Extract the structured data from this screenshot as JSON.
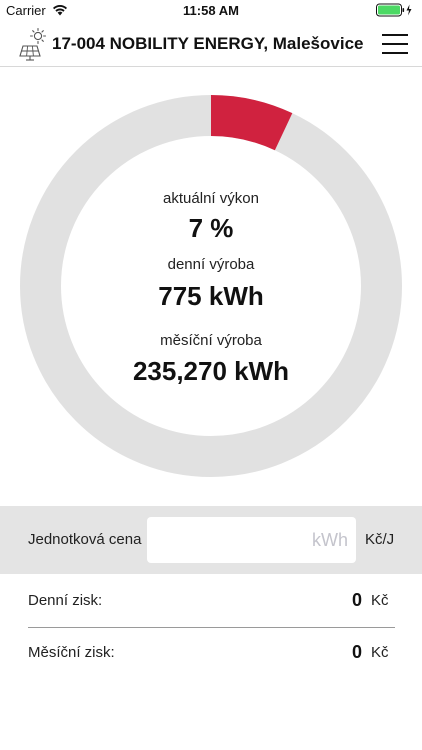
{
  "status_bar": {
    "carrier": "Carrier",
    "time": "11:58 AM",
    "battery_color": "#4cd964"
  },
  "header": {
    "title": "17-004 NOBILITY ENERGY, Malešovice",
    "icons": [
      "solar-panel-icon",
      "hamburger-menu-icon"
    ]
  },
  "gauge": {
    "percent": 7,
    "fill_color": "#d0223f",
    "track_color": "#e1e1e1",
    "current_power_label": "aktuální výkon",
    "current_power_value": "7 %",
    "daily_production_label": "denní výroba",
    "daily_production_value": "775 kWh",
    "monthly_production_label": "měsíční výroba",
    "monthly_production_value": "235,270 kWh"
  },
  "price": {
    "label": "Jednotková cena",
    "placeholder": "kWh",
    "value": "",
    "unit": "Kč/J"
  },
  "profit": {
    "daily_label": "Denní zisk:",
    "daily_value": "0",
    "daily_unit": "Kč",
    "monthly_label": "Měsíční zisk:",
    "monthly_value": "0",
    "monthly_unit": "Kč"
  }
}
